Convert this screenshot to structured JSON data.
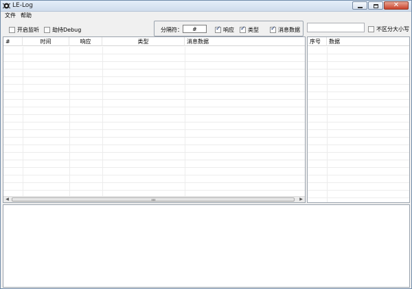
{
  "window": {
    "title": "LE-Log"
  },
  "menu": {
    "items": [
      "文件",
      "帮助"
    ]
  },
  "toolbar": {
    "listen_label": "开启监听",
    "debug_label": "劫持Debug",
    "separator_label": "分隔符：",
    "separator_value": "#",
    "col_toggles": [
      {
        "label": "响应",
        "checked": true
      },
      {
        "label": "类型",
        "checked": true
      },
      {
        "label": "消息数据",
        "checked": true
      }
    ],
    "case_insensitive_label": "不区分大小写",
    "search_value": ""
  },
  "log_table": {
    "columns": [
      "#",
      "时间",
      "响应",
      "类型",
      "消息数据"
    ]
  },
  "search_table": {
    "columns": [
      "序号",
      "数据"
    ]
  }
}
